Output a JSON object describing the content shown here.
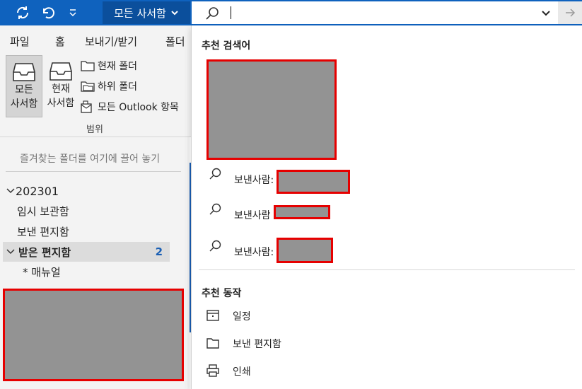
{
  "titlebar": {
    "sync_icon": "sync-icon",
    "undo_icon": "undo-icon",
    "customize_icon": "customize-toolbar-icon",
    "scope_label": "모든 사서함",
    "accent": "#0f62be"
  },
  "search": {
    "value": "",
    "search_icon": "search-icon",
    "dropdown_icon": "chevron-down-icon",
    "go_icon": "arrow-right-icon"
  },
  "ribbon": {
    "tabs": [
      "파일",
      "홈",
      "보내기/받기",
      "폴더"
    ],
    "all_mail_line1": "모든",
    "all_mail_line2": "사서함",
    "cur_mail_line1": "현재",
    "cur_mail_line2": "사서함",
    "current_folder": "현재 폴더",
    "sub_folder": "하위 폴더",
    "all_outlook": "모든 Outlook 항목",
    "group_label": "범위",
    "collapse_icon": "chevron-left-icon"
  },
  "folders": {
    "fav_hint": "즐겨찾는 폴더를 여기에 끌어 놓기",
    "account": "202301",
    "items": [
      {
        "label": "임시 보관함"
      },
      {
        "label": "보낸 편지함"
      }
    ],
    "inbox": {
      "label": "받은 편지함",
      "count": "2"
    },
    "subfolder": "* 매뉴얼"
  },
  "suggestions": {
    "title": "추천 검색어",
    "senders": [
      {
        "label": "보낸사람:"
      },
      {
        "label": "보낸사람"
      },
      {
        "label": "보낸사람:"
      }
    ],
    "actions_title": "추천 동작",
    "actions": [
      {
        "label": "일정",
        "icon": "calendar-icon"
      },
      {
        "label": "보낸 편지함",
        "icon": "folder-icon"
      },
      {
        "label": "인쇄",
        "icon": "printer-icon"
      }
    ]
  },
  "colors": {
    "redaction_fill": "#939393",
    "redaction_border": "#e60000",
    "count_badge": "#1a5fb4"
  }
}
